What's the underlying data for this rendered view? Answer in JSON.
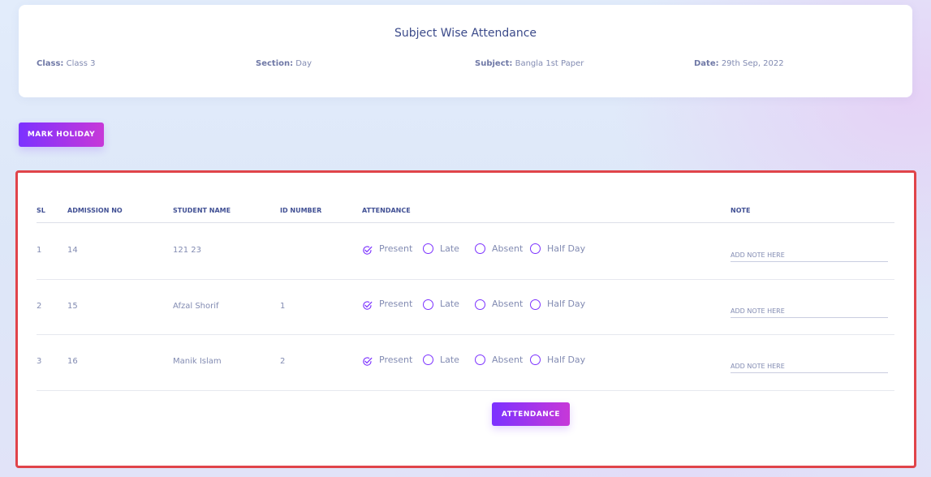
{
  "header": {
    "title": "Subject Wise Attendance",
    "class_label": "Class:",
    "class_value": "Class 3",
    "section_label": "Section:",
    "section_value": "Day",
    "subject_label": "Subject:",
    "subject_value": "Bangla 1st Paper",
    "date_label": "Date:",
    "date_value": "29th Sep, 2022"
  },
  "mark_holiday_label": "MARK HOLIDAY",
  "table": {
    "columns": [
      "SL",
      "ADMISSION NO",
      "STUDENT NAME",
      "ID NUMBER",
      "ATTENDANCE",
      "NOTE"
    ],
    "attendance_options": [
      "Present",
      "Late",
      "Absent",
      "Half Day"
    ],
    "note_placeholder": "ADD NOTE HERE",
    "rows": [
      {
        "sl": "1",
        "admission_no": "14",
        "student_name": "121 23",
        "id_number": "",
        "attendance": "Present"
      },
      {
        "sl": "2",
        "admission_no": "15",
        "student_name": "Afzal Shorif",
        "id_number": "1",
        "attendance": "Present"
      },
      {
        "sl": "3",
        "admission_no": "16",
        "student_name": "Manik Islam",
        "id_number": "2",
        "attendance": "Present"
      }
    ]
  },
  "attendance_button_label": "ATTENDANCE",
  "colors": {
    "accent": "#7c32ff",
    "accent_end": "#c738d8",
    "text": "#415094",
    "muted": "#828bb2",
    "highlight_border": "#e0444a"
  },
  "icons": {
    "selected": "check-circle-icon",
    "unselected": "radio-circle-icon"
  }
}
